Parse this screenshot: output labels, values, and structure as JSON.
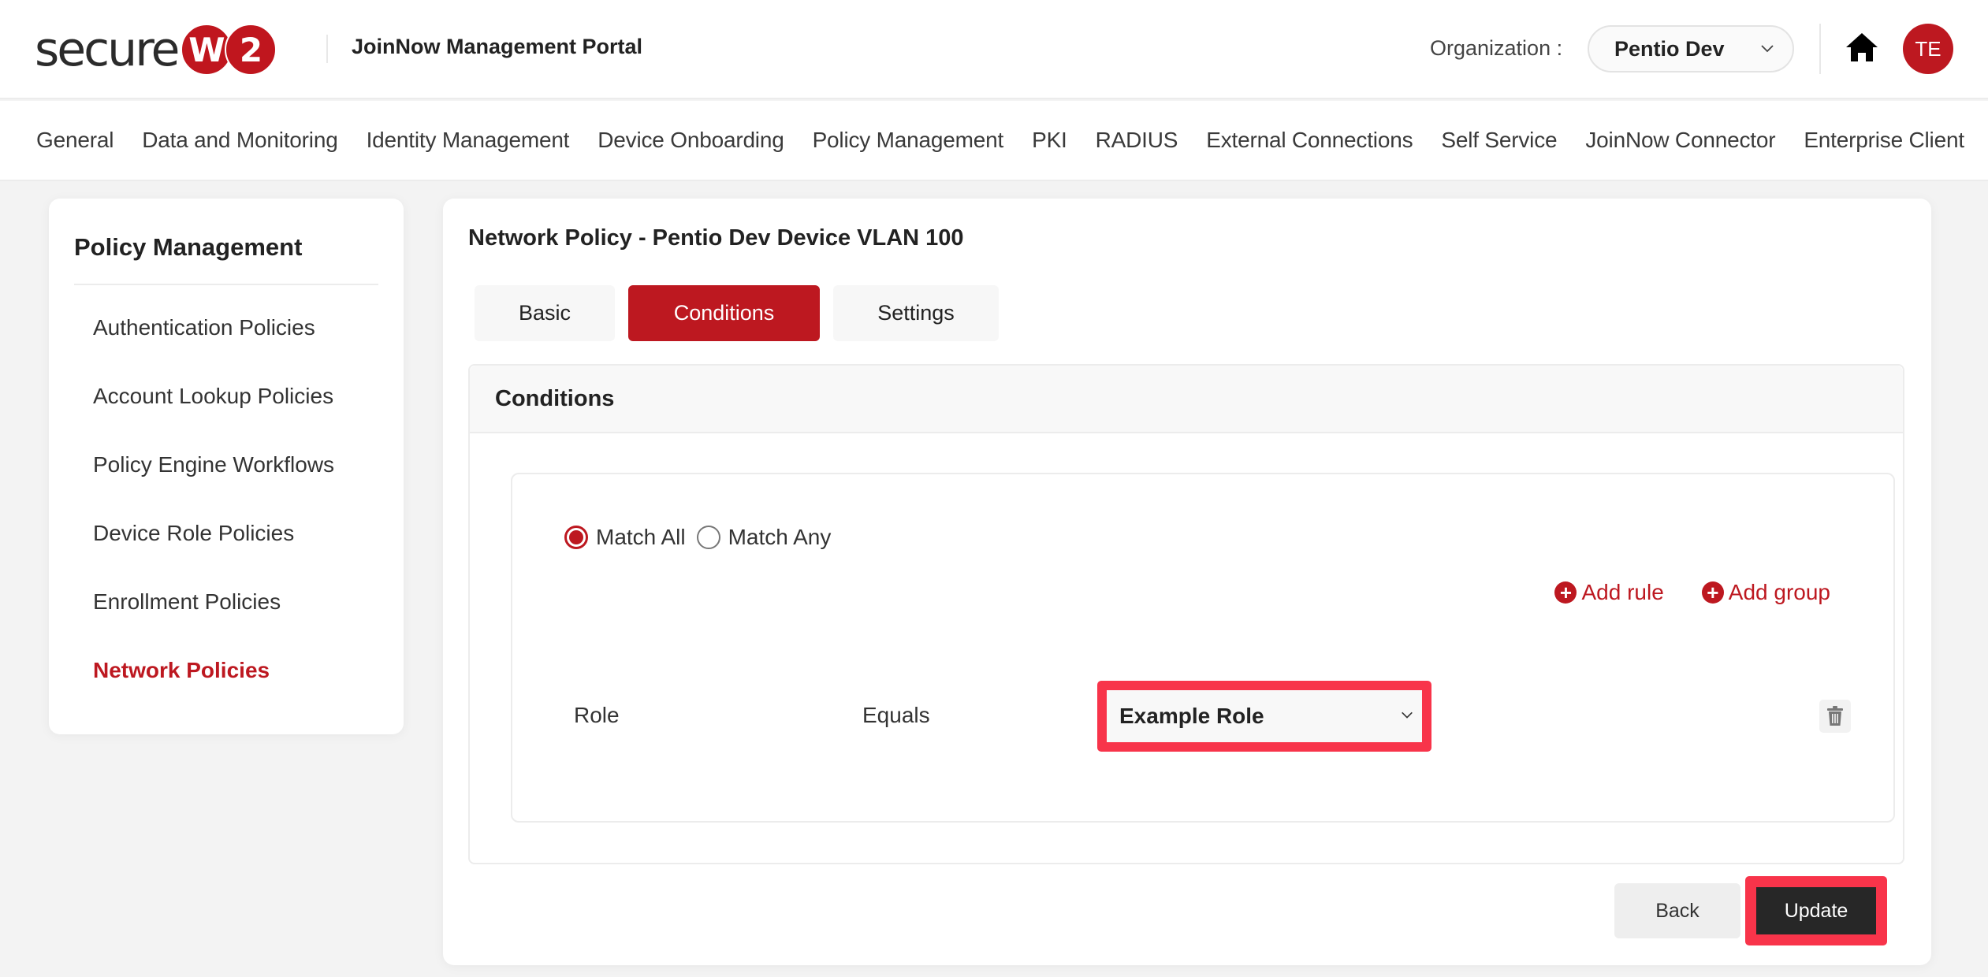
{
  "header": {
    "logo": {
      "text": "secure",
      "circle_1": "W",
      "circle_2": "2",
      "brand_color": "#c0161e"
    },
    "portal_title": "JoinNow Management Portal",
    "organization_label": "Organization :",
    "organization_selected": "Pentio Dev",
    "home_icon": "home-icon",
    "avatar_initials": "TE"
  },
  "nav": {
    "items": [
      "General",
      "Data and Monitoring",
      "Identity Management",
      "Device Onboarding",
      "Policy Management",
      "PKI",
      "RADIUS",
      "External Connections",
      "Self Service",
      "JoinNow Connector",
      "Enterprise Client"
    ]
  },
  "sidebar": {
    "title": "Policy Management",
    "items": [
      {
        "label": "Authentication Policies",
        "active": false
      },
      {
        "label": "Account Lookup Policies",
        "active": false
      },
      {
        "label": "Policy Engine Workflows",
        "active": false
      },
      {
        "label": "Device Role Policies",
        "active": false
      },
      {
        "label": "Enrollment Policies",
        "active": false
      },
      {
        "label": "Network Policies",
        "active": true
      }
    ],
    "active_color": "#bd1820"
  },
  "main": {
    "title": "Network Policy - Pentio Dev Device VLAN 100",
    "tabs": [
      {
        "label": "Basic",
        "active": false
      },
      {
        "label": "Conditions",
        "active": true
      },
      {
        "label": "Settings",
        "active": false
      }
    ],
    "conditions": {
      "title": "Conditions",
      "match_options": [
        {
          "label": "Match All",
          "checked": true
        },
        {
          "label": "Match Any",
          "checked": false
        }
      ],
      "add_rule_label": "Add rule",
      "add_group_label": "Add group",
      "rules": [
        {
          "field": "Role",
          "operator": "Equals",
          "value": "Example Role",
          "highlighted": true
        }
      ]
    },
    "actions": {
      "back_label": "Back",
      "update_label": "Update",
      "update_highlighted": true
    }
  },
  "colors": {
    "accent": "#bd1820",
    "highlight": "#f8344a",
    "primary_button": "#272727"
  }
}
